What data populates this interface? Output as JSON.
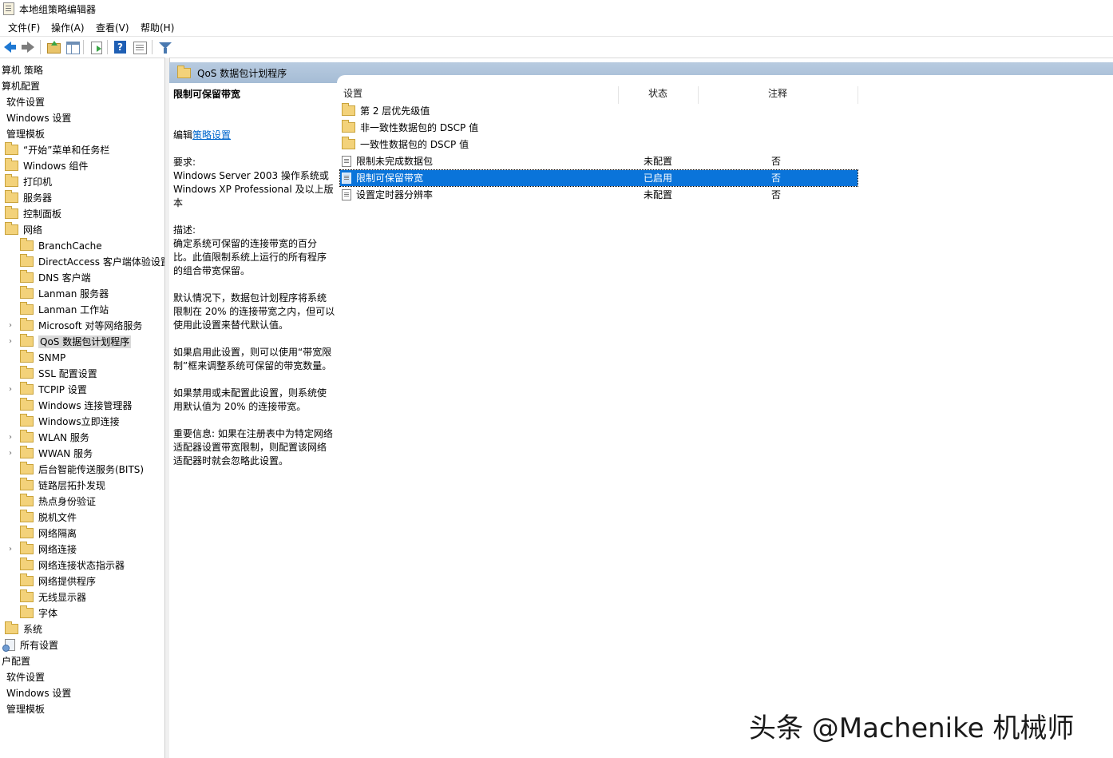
{
  "window": {
    "title": "本地组策略编辑器"
  },
  "menu": [
    "文件(F)",
    "操作(A)",
    "查看(V)",
    "帮助(H)"
  ],
  "toolbar": {
    "icons": [
      "back-arrow-icon",
      "forward-arrow-icon",
      "up-folder-icon",
      "show-hide-tree-icon",
      "export-list-icon",
      "help-icon",
      "properties-icon",
      "filter-icon"
    ]
  },
  "tree": [
    {
      "label": "算机 策略"
    },
    {
      "label": "算机配置"
    },
    {
      "label": "软件设置"
    },
    {
      "label": "Windows 设置"
    },
    {
      "label": "管理模板"
    },
    {
      "label": "“开始”菜单和任务栏"
    },
    {
      "label": "Windows 组件"
    },
    {
      "label": "打印机"
    },
    {
      "label": "服务器"
    },
    {
      "label": "控制面板"
    },
    {
      "label": "网络"
    },
    {
      "label": "BranchCache"
    },
    {
      "label": "DirectAccess 客户端体验设置"
    },
    {
      "label": "DNS 客户端"
    },
    {
      "label": "Lanman 服务器"
    },
    {
      "label": "Lanman 工作站"
    },
    {
      "label": "Microsoft 对等网络服务"
    },
    {
      "label": "QoS 数据包计划程序"
    },
    {
      "label": "SNMP"
    },
    {
      "label": "SSL 配置设置"
    },
    {
      "label": "TCPIP 设置"
    },
    {
      "label": "Windows 连接管理器"
    },
    {
      "label": "Windows立即连接"
    },
    {
      "label": "WLAN 服务"
    },
    {
      "label": "WWAN 服务"
    },
    {
      "label": "后台智能传送服务(BITS)"
    },
    {
      "label": "链路层拓扑发现"
    },
    {
      "label": "热点身份验证"
    },
    {
      "label": "脱机文件"
    },
    {
      "label": "网络隔离"
    },
    {
      "label": "网络连接"
    },
    {
      "label": "网络连接状态指示器"
    },
    {
      "label": "网络提供程序"
    },
    {
      "label": "无线显示器"
    },
    {
      "label": "字体"
    },
    {
      "label": "系统"
    },
    {
      "label": "所有设置"
    },
    {
      "label": "户配置"
    },
    {
      "label": "软件设置"
    },
    {
      "label": "Windows 设置"
    },
    {
      "label": "管理模板"
    }
  ],
  "breadcrumb": {
    "title": "QoS 数据包计划程序"
  },
  "description": {
    "heading": "限制可保留带宽",
    "edit_prefix": "编辑",
    "edit_link": "策略设置",
    "req_label": "要求:",
    "req_line1": "Windows Server 2003 操作系统或",
    "req_line2": "Windows XP Professional 及以上版",
    "req_line3": "本",
    "desc_label": "描述:",
    "d1": "确定系统可保留的连接带宽的百分",
    "d2": "比。此值限制系统上运行的所有程序",
    "d3": "的组合带宽保留。",
    "d4": "默认情况下，数据包计划程序将系统",
    "d5": "限制在 20% 的连接带宽之内，但可以",
    "d6": "使用此设置来替代默认值。",
    "d7": "如果启用此设置，则可以使用“带宽限",
    "d8": "制”框来调整系统可保留的带宽数量。",
    "d9": "如果禁用或未配置此设置，则系统使",
    "d10": "用默认值为 20% 的连接带宽。",
    "d11": "重要信息: 如果在注册表中为特定网络",
    "d12": "适配器设置带宽限制，则配置该网络",
    "d13": "适配器时就会忽略此设置。"
  },
  "list": {
    "columns": {
      "setting": "设置",
      "state": "状态",
      "comment": "注释"
    },
    "rows": [
      {
        "name": "第 2 层优先级值",
        "state": "",
        "comment": ""
      },
      {
        "name": "非一致性数据包的 DSCP 值",
        "state": "",
        "comment": ""
      },
      {
        "name": "一致性数据包的 DSCP 值",
        "state": "",
        "comment": ""
      },
      {
        "name": "限制未完成数据包",
        "state": "未配置",
        "comment": "否"
      },
      {
        "name": "限制可保留带宽",
        "state": "已启用",
        "comment": "否"
      },
      {
        "name": "设置定时器分辨率",
        "state": "未配置",
        "comment": "否"
      }
    ]
  },
  "watermark": "头条 @Machenike 机械师",
  "colors": {
    "selection": "#0a74da",
    "breadcrumb_bg": "#b8cbe0",
    "link": "#0066cc",
    "folder": "#f3d27a"
  }
}
